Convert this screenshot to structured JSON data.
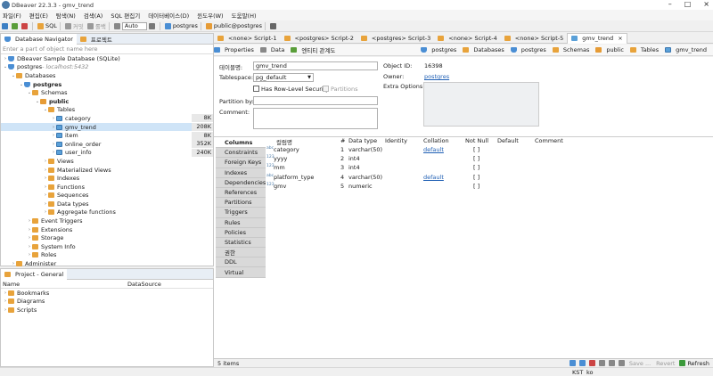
{
  "window": {
    "title": "DBeaver 22.3.3 - gmv_trend"
  },
  "menu": [
    "파일(F)",
    "편집(E)",
    "탐색(N)",
    "검색(A)",
    "SQL 편집기",
    "데이터베이스(D)",
    "윈도우(W)",
    "도움말(H)"
  ],
  "toolbar": {
    "sql_label": "SQL",
    "commit_label": "커밋",
    "rollback_label": "롤백",
    "mode": "Auto",
    "conn": "postgres",
    "schema": "public@postgres"
  },
  "navigator": {
    "tabs": [
      "Database Navigator",
      "프로젝트"
    ],
    "filter_placeholder": "Enter a part of object name here",
    "tree": [
      {
        "label": "DBeaver Sample Database (SQLite)",
        "level": 0,
        "icon": "db",
        "arrow": "›"
      },
      {
        "label": "postgres",
        "suffix": " - localhost:5432",
        "level": 0,
        "icon": "db",
        "arrow": "⌄"
      },
      {
        "label": "Databases",
        "level": 1,
        "icon": "folder",
        "arrow": "⌄"
      },
      {
        "label": "postgres",
        "level": 2,
        "icon": "db",
        "arrow": "⌄",
        "bold": true
      },
      {
        "label": "Schemas",
        "level": 3,
        "icon": "folder",
        "arrow": "⌄"
      },
      {
        "label": "public",
        "level": 4,
        "icon": "schema",
        "arrow": "⌄",
        "bold": true
      },
      {
        "label": "Tables",
        "level": 5,
        "icon": "folder",
        "arrow": "⌄"
      },
      {
        "label": "category",
        "level": 6,
        "icon": "tbl",
        "arrow": "›",
        "size": "8K"
      },
      {
        "label": "gmv_trend",
        "level": 6,
        "icon": "tbl",
        "arrow": "›",
        "size": "208K",
        "selected": true
      },
      {
        "label": "item",
        "level": 6,
        "icon": "tbl",
        "arrow": "›",
        "size": "8K"
      },
      {
        "label": "online_order",
        "level": 6,
        "icon": "tbl",
        "arrow": "›",
        "size": "352K"
      },
      {
        "label": "user_info",
        "level": 6,
        "icon": "tbl",
        "arrow": "›",
        "size": "240K"
      },
      {
        "label": "Views",
        "level": 5,
        "icon": "folder",
        "arrow": "›"
      },
      {
        "label": "Materialized Views",
        "level": 5,
        "icon": "folder",
        "arrow": "›"
      },
      {
        "label": "Indexes",
        "level": 5,
        "icon": "folder",
        "arrow": "›"
      },
      {
        "label": "Functions",
        "level": 5,
        "icon": "folder",
        "arrow": "›"
      },
      {
        "label": "Sequences",
        "level": 5,
        "icon": "folder",
        "arrow": "›"
      },
      {
        "label": "Data types",
        "level": 5,
        "icon": "folder",
        "arrow": "›"
      },
      {
        "label": "Aggregate functions",
        "level": 5,
        "icon": "folder",
        "arrow": "›"
      },
      {
        "label": "Event Triggers",
        "level": 3,
        "icon": "folder",
        "arrow": "›"
      },
      {
        "label": "Extensions",
        "level": 3,
        "icon": "folder",
        "arrow": "›"
      },
      {
        "label": "Storage",
        "level": 3,
        "icon": "folder",
        "arrow": "›"
      },
      {
        "label": "System Info",
        "level": 3,
        "icon": "folder",
        "arrow": "›"
      },
      {
        "label": "Roles",
        "level": 3,
        "icon": "folder",
        "arrow": "›"
      },
      {
        "label": "Administer",
        "level": 1,
        "icon": "folder",
        "arrow": "›"
      }
    ]
  },
  "project": {
    "tab": "Project - General",
    "col_name": "Name",
    "col_ds": "DataSource",
    "items": [
      "Bookmarks",
      "Diagrams",
      "Scripts"
    ]
  },
  "editor_tabs": [
    {
      "label": "<none> Script-1",
      "active": false
    },
    {
      "label": "<postgres> Script-2",
      "active": false
    },
    {
      "label": "<postgres> Script-3",
      "active": false
    },
    {
      "label": "<none> Script-4",
      "active": false
    },
    {
      "label": "<none> Script-5",
      "active": false
    },
    {
      "label": "gmv_trend",
      "active": true
    }
  ],
  "subtabs": {
    "properties": "Properties",
    "data": "Data",
    "er": "엔티티 관계도"
  },
  "crumbs": [
    "postgres",
    "Databases",
    "postgres",
    "Schemas",
    "public",
    "Tables",
    "gmv_trend"
  ],
  "form": {
    "table_name_label": "테이블명:",
    "table_name": "gmv_trend",
    "tablespace_label": "Tablespace:",
    "tablespace": "pg_default",
    "rls_label": "Has Row-Level Security",
    "partitions_label": "Partitions",
    "partition_by_label": "Partition by:",
    "comment_label": "Comment:",
    "object_id_label": "Object ID:",
    "object_id": "16398",
    "owner_label": "Owner:",
    "owner": "postgres",
    "extra_label": "Extra Options:"
  },
  "left_tabs": [
    "Columns",
    "Constraints",
    "Foreign Keys",
    "Indexes",
    "Dependencies",
    "References",
    "Partitions",
    "Triggers",
    "Rules",
    "Policies",
    "Statistics",
    "권한",
    "DDL",
    "Virtual"
  ],
  "columns_grid": {
    "headers": [
      "컬럼명",
      "#",
      "Data type",
      "Identity",
      "Collation",
      "Not Null",
      "Default",
      "Comment"
    ],
    "rows": [
      {
        "name": "category",
        "num": "1",
        "type": "varchar(50)",
        "collation": "default",
        "notnull": "[ ]",
        "kind": "abc"
      },
      {
        "name": "yyyy",
        "num": "2",
        "type": "int4",
        "collation": "",
        "notnull": "[ ]",
        "kind": "123"
      },
      {
        "name": "mm",
        "num": "3",
        "type": "int4",
        "collation": "",
        "notnull": "[ ]",
        "kind": "123"
      },
      {
        "name": "platform_type",
        "num": "4",
        "type": "varchar(50)",
        "collation": "default",
        "notnull": "[ ]",
        "kind": "abc"
      },
      {
        "name": "gmv",
        "num": "5",
        "type": "numeric",
        "collation": "",
        "notnull": "[ ]",
        "kind": "123"
      }
    ]
  },
  "status": {
    "items": "5 items",
    "save": "Save ...",
    "revert": "Revert",
    "refresh": "Refresh"
  },
  "bottom": {
    "tz": "KST",
    "locale": "ko"
  }
}
